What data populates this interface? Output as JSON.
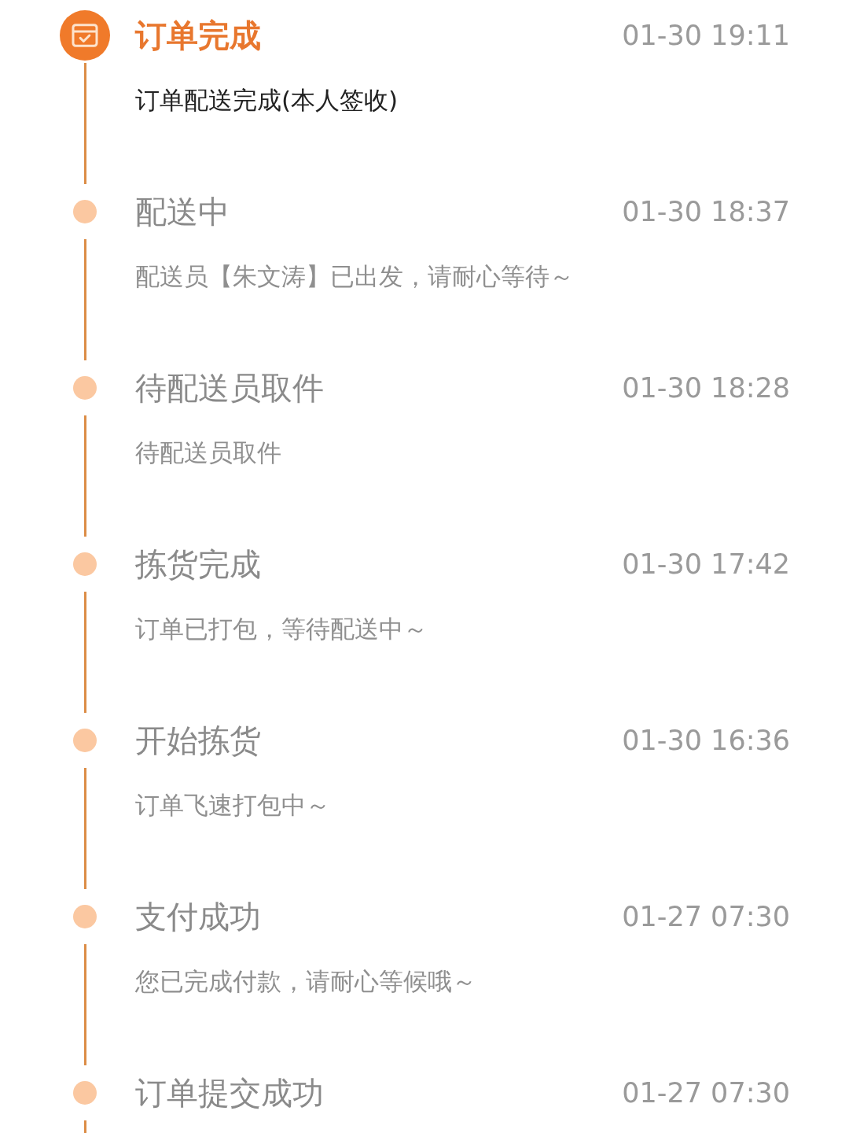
{
  "steps": [
    {
      "kind": "current",
      "title": "订单完成",
      "time": "01-30 19:11",
      "description": "订单配送完成(本人签收)"
    },
    {
      "kind": "past",
      "title": "配送中",
      "time": "01-30 18:37",
      "description": "配送员【朱文涛】已出发，请耐心等待～"
    },
    {
      "kind": "past",
      "title": "待配送员取件",
      "time": "01-30 18:28",
      "description": "待配送员取件"
    },
    {
      "kind": "past",
      "title": "拣货完成",
      "time": "01-30 17:42",
      "description": "订单已打包，等待配送中～"
    },
    {
      "kind": "past",
      "title": "开始拣货",
      "time": "01-30 16:36",
      "description": "订单飞速打包中～"
    },
    {
      "kind": "past",
      "title": "支付成功",
      "time": "01-27 07:30",
      "description": "您已完成付款，请耐心等候哦～"
    },
    {
      "kind": "past",
      "title": "订单提交成功",
      "time": "01-27 07:30"
    }
  ]
}
